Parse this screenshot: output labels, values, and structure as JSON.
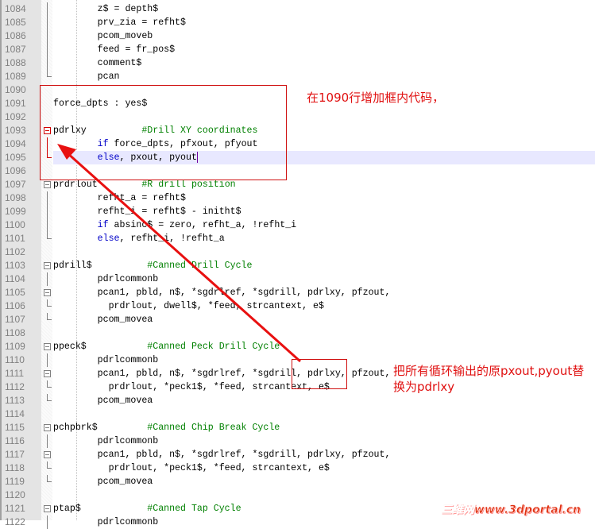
{
  "editor": {
    "lines": [
      {
        "n": "1084",
        "code": [
          {
            "t": "        z$ = depth$"
          }
        ],
        "fold": "line"
      },
      {
        "n": "1085",
        "code": [
          {
            "t": "        prv_zia = refht$"
          }
        ],
        "fold": "line"
      },
      {
        "n": "1086",
        "code": [
          {
            "t": "        pcom_moveb"
          }
        ],
        "fold": "line"
      },
      {
        "n": "1087",
        "code": [
          {
            "t": "        feed = fr_pos$"
          }
        ],
        "fold": "line"
      },
      {
        "n": "1088",
        "code": [
          {
            "t": "        comment$"
          }
        ],
        "fold": "line"
      },
      {
        "n": "1089",
        "code": [
          {
            "t": "        pcan"
          }
        ],
        "fold": "end"
      },
      {
        "n": "1090",
        "code": [
          {
            "t": ""
          }
        ]
      },
      {
        "n": "1091",
        "code": [
          {
            "t": "force_dpts : yes$"
          }
        ]
      },
      {
        "n": "1092",
        "code": [
          {
            "t": ""
          }
        ]
      },
      {
        "n": "1093",
        "code": [
          {
            "t": "pdrlxy          "
          },
          {
            "t": "#Drill XY coordinates",
            "c": "cm"
          }
        ],
        "fold": "box-red"
      },
      {
        "n": "1094",
        "code": [
          {
            "t": "        "
          },
          {
            "t": "if",
            "c": "kw"
          },
          {
            "t": " force_dpts, pfxout, pfyout"
          }
        ],
        "fold": "line-red"
      },
      {
        "n": "1095",
        "code": [
          {
            "t": "        "
          },
          {
            "t": "else",
            "c": "kw"
          },
          {
            "t": ", pxout, pyout"
          }
        ],
        "fold": "end-red",
        "highlight": true,
        "cursor": true
      },
      {
        "n": "1096",
        "code": [
          {
            "t": ""
          }
        ]
      },
      {
        "n": "1097",
        "code": [
          {
            "t": "prdrlout        "
          },
          {
            "t": "#R drill position",
            "c": "cm"
          }
        ],
        "fold": "box"
      },
      {
        "n": "1098",
        "code": [
          {
            "t": "        refht_a = refht$"
          }
        ],
        "fold": "line"
      },
      {
        "n": "1099",
        "code": [
          {
            "t": "        refht_i = refht$ - initht$"
          }
        ],
        "fold": "line"
      },
      {
        "n": "1100",
        "code": [
          {
            "t": "        "
          },
          {
            "t": "if",
            "c": "kw"
          },
          {
            "t": " absinc$ = zero, refht_a, !refht_i"
          }
        ],
        "fold": "line"
      },
      {
        "n": "1101",
        "code": [
          {
            "t": "        "
          },
          {
            "t": "else",
            "c": "kw"
          },
          {
            "t": ", refht_i, !refht_a"
          }
        ],
        "fold": "end"
      },
      {
        "n": "1102",
        "code": [
          {
            "t": ""
          }
        ]
      },
      {
        "n": "1103",
        "code": [
          {
            "t": "pdrill$          "
          },
          {
            "t": "#Canned Drill Cycle",
            "c": "cm"
          }
        ],
        "fold": "box"
      },
      {
        "n": "1104",
        "code": [
          {
            "t": "        pdrlcommonb"
          }
        ],
        "fold": "line"
      },
      {
        "n": "1105",
        "code": [
          {
            "t": "        pcan1, pbld, n$, *sgdrlref, *sgdrill, pdrlxy, pfzout,"
          }
        ],
        "fold": "box"
      },
      {
        "n": "1106",
        "code": [
          {
            "t": "          prdrlout, dwell$, *feed, strcantext, e$"
          }
        ],
        "fold": "end"
      },
      {
        "n": "1107",
        "code": [
          {
            "t": "        pcom_movea"
          }
        ],
        "fold": "end"
      },
      {
        "n": "1108",
        "code": [
          {
            "t": ""
          }
        ]
      },
      {
        "n": "1109",
        "code": [
          {
            "t": "ppeck$           "
          },
          {
            "t": "#Canned Peck Drill Cycle",
            "c": "cm"
          }
        ],
        "fold": "box"
      },
      {
        "n": "1110",
        "code": [
          {
            "t": "        pdrlcommonb"
          }
        ],
        "fold": "line"
      },
      {
        "n": "1111",
        "code": [
          {
            "t": "        pcan1, pbld, n$, *sgdrlref, *sgdrill, pdrlxy, pfzout,"
          }
        ],
        "fold": "box"
      },
      {
        "n": "1112",
        "code": [
          {
            "t": "          prdrlout, *peck1$, *feed, strcantext, e$"
          }
        ],
        "fold": "end"
      },
      {
        "n": "1113",
        "code": [
          {
            "t": "        pcom_movea"
          }
        ],
        "fold": "end"
      },
      {
        "n": "1114",
        "code": [
          {
            "t": ""
          }
        ]
      },
      {
        "n": "1115",
        "code": [
          {
            "t": "pchpbrk$         "
          },
          {
            "t": "#Canned Chip Break Cycle",
            "c": "cm"
          }
        ],
        "fold": "box"
      },
      {
        "n": "1116",
        "code": [
          {
            "t": "        pdrlcommonb"
          }
        ],
        "fold": "line"
      },
      {
        "n": "1117",
        "code": [
          {
            "t": "        pcan1, pbld, n$, *sgdrlref, *sgdrill, pdrlxy, pfzout,"
          }
        ],
        "fold": "box"
      },
      {
        "n": "1118",
        "code": [
          {
            "t": "          prdrlout, *peck1$, *feed, strcantext, e$"
          }
        ],
        "fold": "end"
      },
      {
        "n": "1119",
        "code": [
          {
            "t": "        pcom_movea"
          }
        ],
        "fold": "end"
      },
      {
        "n": "1120",
        "code": [
          {
            "t": ""
          }
        ]
      },
      {
        "n": "1121",
        "code": [
          {
            "t": "ptap$            "
          },
          {
            "t": "#Canned Tap Cycle",
            "c": "cm"
          }
        ],
        "fold": "box"
      },
      {
        "n": "1122",
        "code": [
          {
            "t": "        pdrlcommonb"
          }
        ],
        "fold": "line"
      }
    ]
  },
  "annotations": {
    "note1": "在1090行增加框内代码，",
    "note2_line1": "把所有循环输出的原pxout,pyout替",
    "note2_line2": "换为pdrlxy",
    "color": "#e01010"
  },
  "watermark": "三维网www.3dportal.cn"
}
